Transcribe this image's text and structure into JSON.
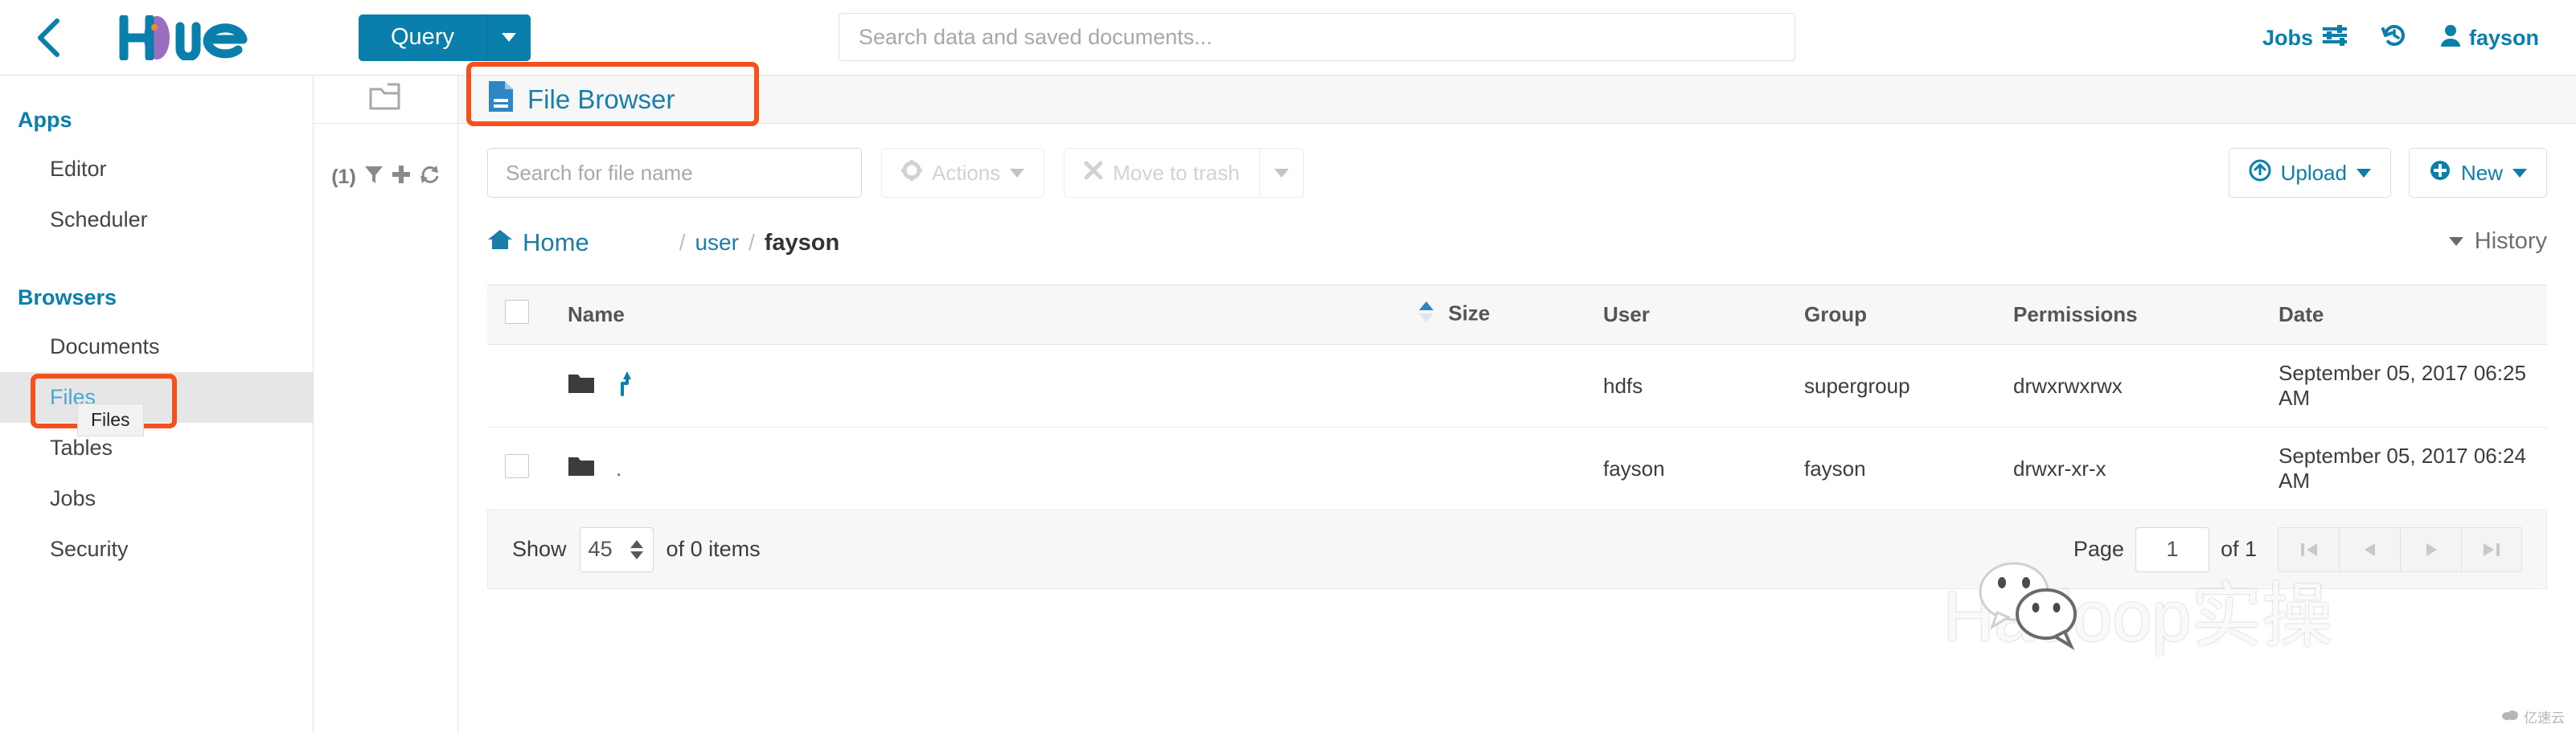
{
  "navbar": {
    "back_icon": "chevron-left-icon",
    "brand": "Hue",
    "query_label": "Query",
    "search_placeholder": "Search data and saved documents...",
    "search_value": "",
    "jobs_label": "Jobs",
    "jobs_icon": "sliders-icon",
    "history_icon": "history-clock-icon",
    "user_label": "fayson",
    "user_icon": "user-icon"
  },
  "sidebar": {
    "sections": [
      {
        "title": "Apps",
        "items": [
          {
            "label": "Editor",
            "active": false
          },
          {
            "label": "Scheduler",
            "active": false
          }
        ]
      },
      {
        "title": "Browsers",
        "items": [
          {
            "label": "Documents",
            "active": false
          },
          {
            "label": "Files",
            "active": true
          },
          {
            "label": "Tables",
            "active": false
          },
          {
            "label": "Jobs",
            "active": false
          },
          {
            "label": "Security",
            "active": false
          }
        ]
      }
    ],
    "tooltip": "Files"
  },
  "assist": {
    "folder_icon": "open-folder-icon",
    "count_label": "(1)",
    "filter_icon": "funnel-icon",
    "add_icon": "plus-icon",
    "refresh_icon": "refresh-icon"
  },
  "page": {
    "title": "File Browser",
    "title_icon": "file-document-icon"
  },
  "toolbar": {
    "search_placeholder": "Search for file name",
    "search_value": "",
    "actions_label": "Actions",
    "actions_icon": "gear-icon",
    "trash_label": "Move to trash",
    "trash_icon": "x-icon",
    "upload_label": "Upload",
    "upload_icon": "upload-circle-icon",
    "new_label": "New",
    "new_icon": "plus-circle-icon"
  },
  "breadcrumb": {
    "home_label": "Home",
    "home_icon": "home-icon",
    "separator": "/",
    "segments": [
      {
        "label": "user",
        "current": false
      },
      {
        "label": "fayson",
        "current": true
      }
    ],
    "history_label": "History"
  },
  "table": {
    "columns": [
      "Name",
      "Size",
      "User",
      "Group",
      "Permissions",
      "Date"
    ],
    "sorted_column": "Size",
    "sort_direction": "asc",
    "rows": [
      {
        "icon": "folder-icon",
        "link_icon": "arrow-up-parent-icon",
        "name": "..",
        "name_display": "",
        "size": "",
        "user": "hdfs",
        "group": "supergroup",
        "permissions": "drwxrwxrwx",
        "date": "September 05, 2017 06:25 AM",
        "has_checkbox": false
      },
      {
        "icon": "folder-icon",
        "link_icon": "",
        "name": ".",
        "name_display": ".",
        "size": "",
        "user": "fayson",
        "group": "fayson",
        "permissions": "drwxr-xr-x",
        "date": "September 05, 2017 06:24 AM",
        "has_checkbox": true
      }
    ]
  },
  "footer": {
    "show_label": "Show",
    "page_size": "45",
    "items_label": "of 0 items",
    "page_label": "Page",
    "page_number": "1",
    "page_total_label": "of 1",
    "first_icon": "first-page-icon",
    "prev_icon": "prev-page-icon",
    "next_icon": "next-page-icon",
    "last_icon": "last-page-icon"
  },
  "watermark": {
    "text": "Hadoop实操",
    "corner_text": "亿速云"
  },
  "colors": {
    "accent": "#0b7fab",
    "highlight_box": "#f4511e",
    "link": "#1a7fa8",
    "active_bg": "#e6e6e6"
  }
}
